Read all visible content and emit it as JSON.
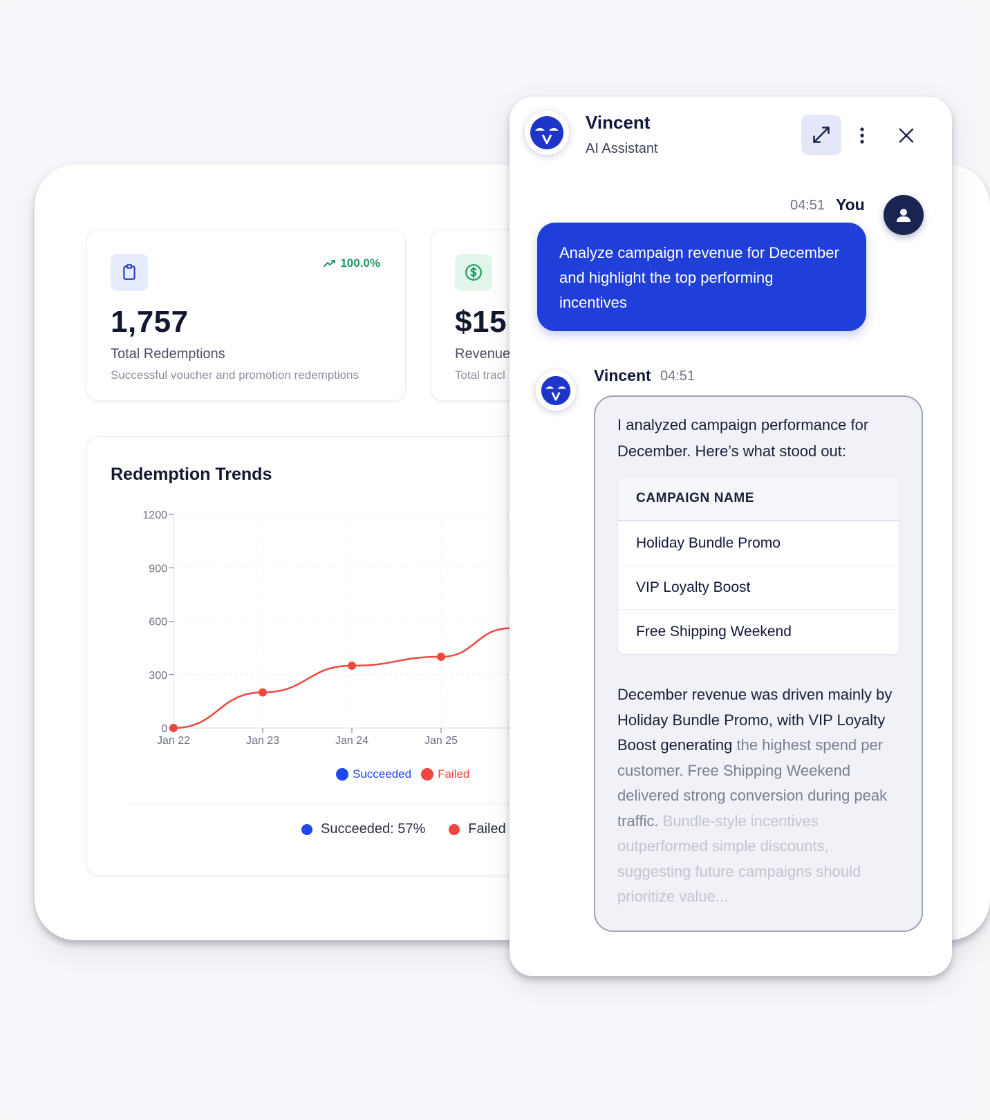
{
  "stats": [
    {
      "icon": "clipboard-icon",
      "trend": "100.0%",
      "value": "1,757",
      "label": "Total Redemptions",
      "desc": "Successful voucher and promotion redemptions"
    },
    {
      "icon": "dollar-icon",
      "value": "$15",
      "label": "Revenue",
      "desc": "Total tracl"
    }
  ],
  "trend_card": {
    "title": "Redemption Trends",
    "legend": [
      {
        "label": "Succeeded",
        "color": "#1f47f0"
      },
      {
        "label": "Failed",
        "color": "#f0473f"
      }
    ],
    "summary": [
      {
        "label": "Succeeded: 57%",
        "color": "#1f47f0"
      },
      {
        "label": "Failed",
        "color": "#f0473f"
      }
    ]
  },
  "chart_data": {
    "type": "line",
    "title": "Redemption Trends",
    "x": [
      "Jan 22",
      "Jan 23",
      "Jan 24",
      "Jan 25"
    ],
    "yticks": [
      0,
      300,
      600,
      900,
      1200
    ],
    "ylim": [
      0,
      1200
    ],
    "grid": true,
    "legend_position": "bottom",
    "series": [
      {
        "name": "Failed",
        "color": "#f0473f",
        "values": [
          0,
          200,
          350,
          400
        ]
      }
    ],
    "continuation_value": 560
  },
  "chat": {
    "name": "Vincent",
    "subtitle": "AI Assistant",
    "avatar_letter": "V",
    "user_message": {
      "time": "04:51",
      "author": "You",
      "text": "Analyze campaign revenue for December and highlight the top performing incentives"
    },
    "ai_message": {
      "author": "Vincent",
      "time": "04:51",
      "intro": "I analyzed campaign performance for December. Here’s what stood out:",
      "table_header": "CAMPAIGN NAME",
      "campaigns": [
        "Holiday Bundle Promo",
        "VIP Loyalty Boost",
        "Free Shipping Weekend"
      ],
      "para_part1": "December revenue was driven mainly by Holiday Bundle Promo, with VIP Loyalty Boost generating",
      "para_part2": "the highest spend per customer. Free Shipping Weekend delivered strong conversion during peak traffic.",
      "para_part3": "Bundle-style incentives outperformed simple discounts, suggesting future campaigns should prioritize value..."
    }
  }
}
